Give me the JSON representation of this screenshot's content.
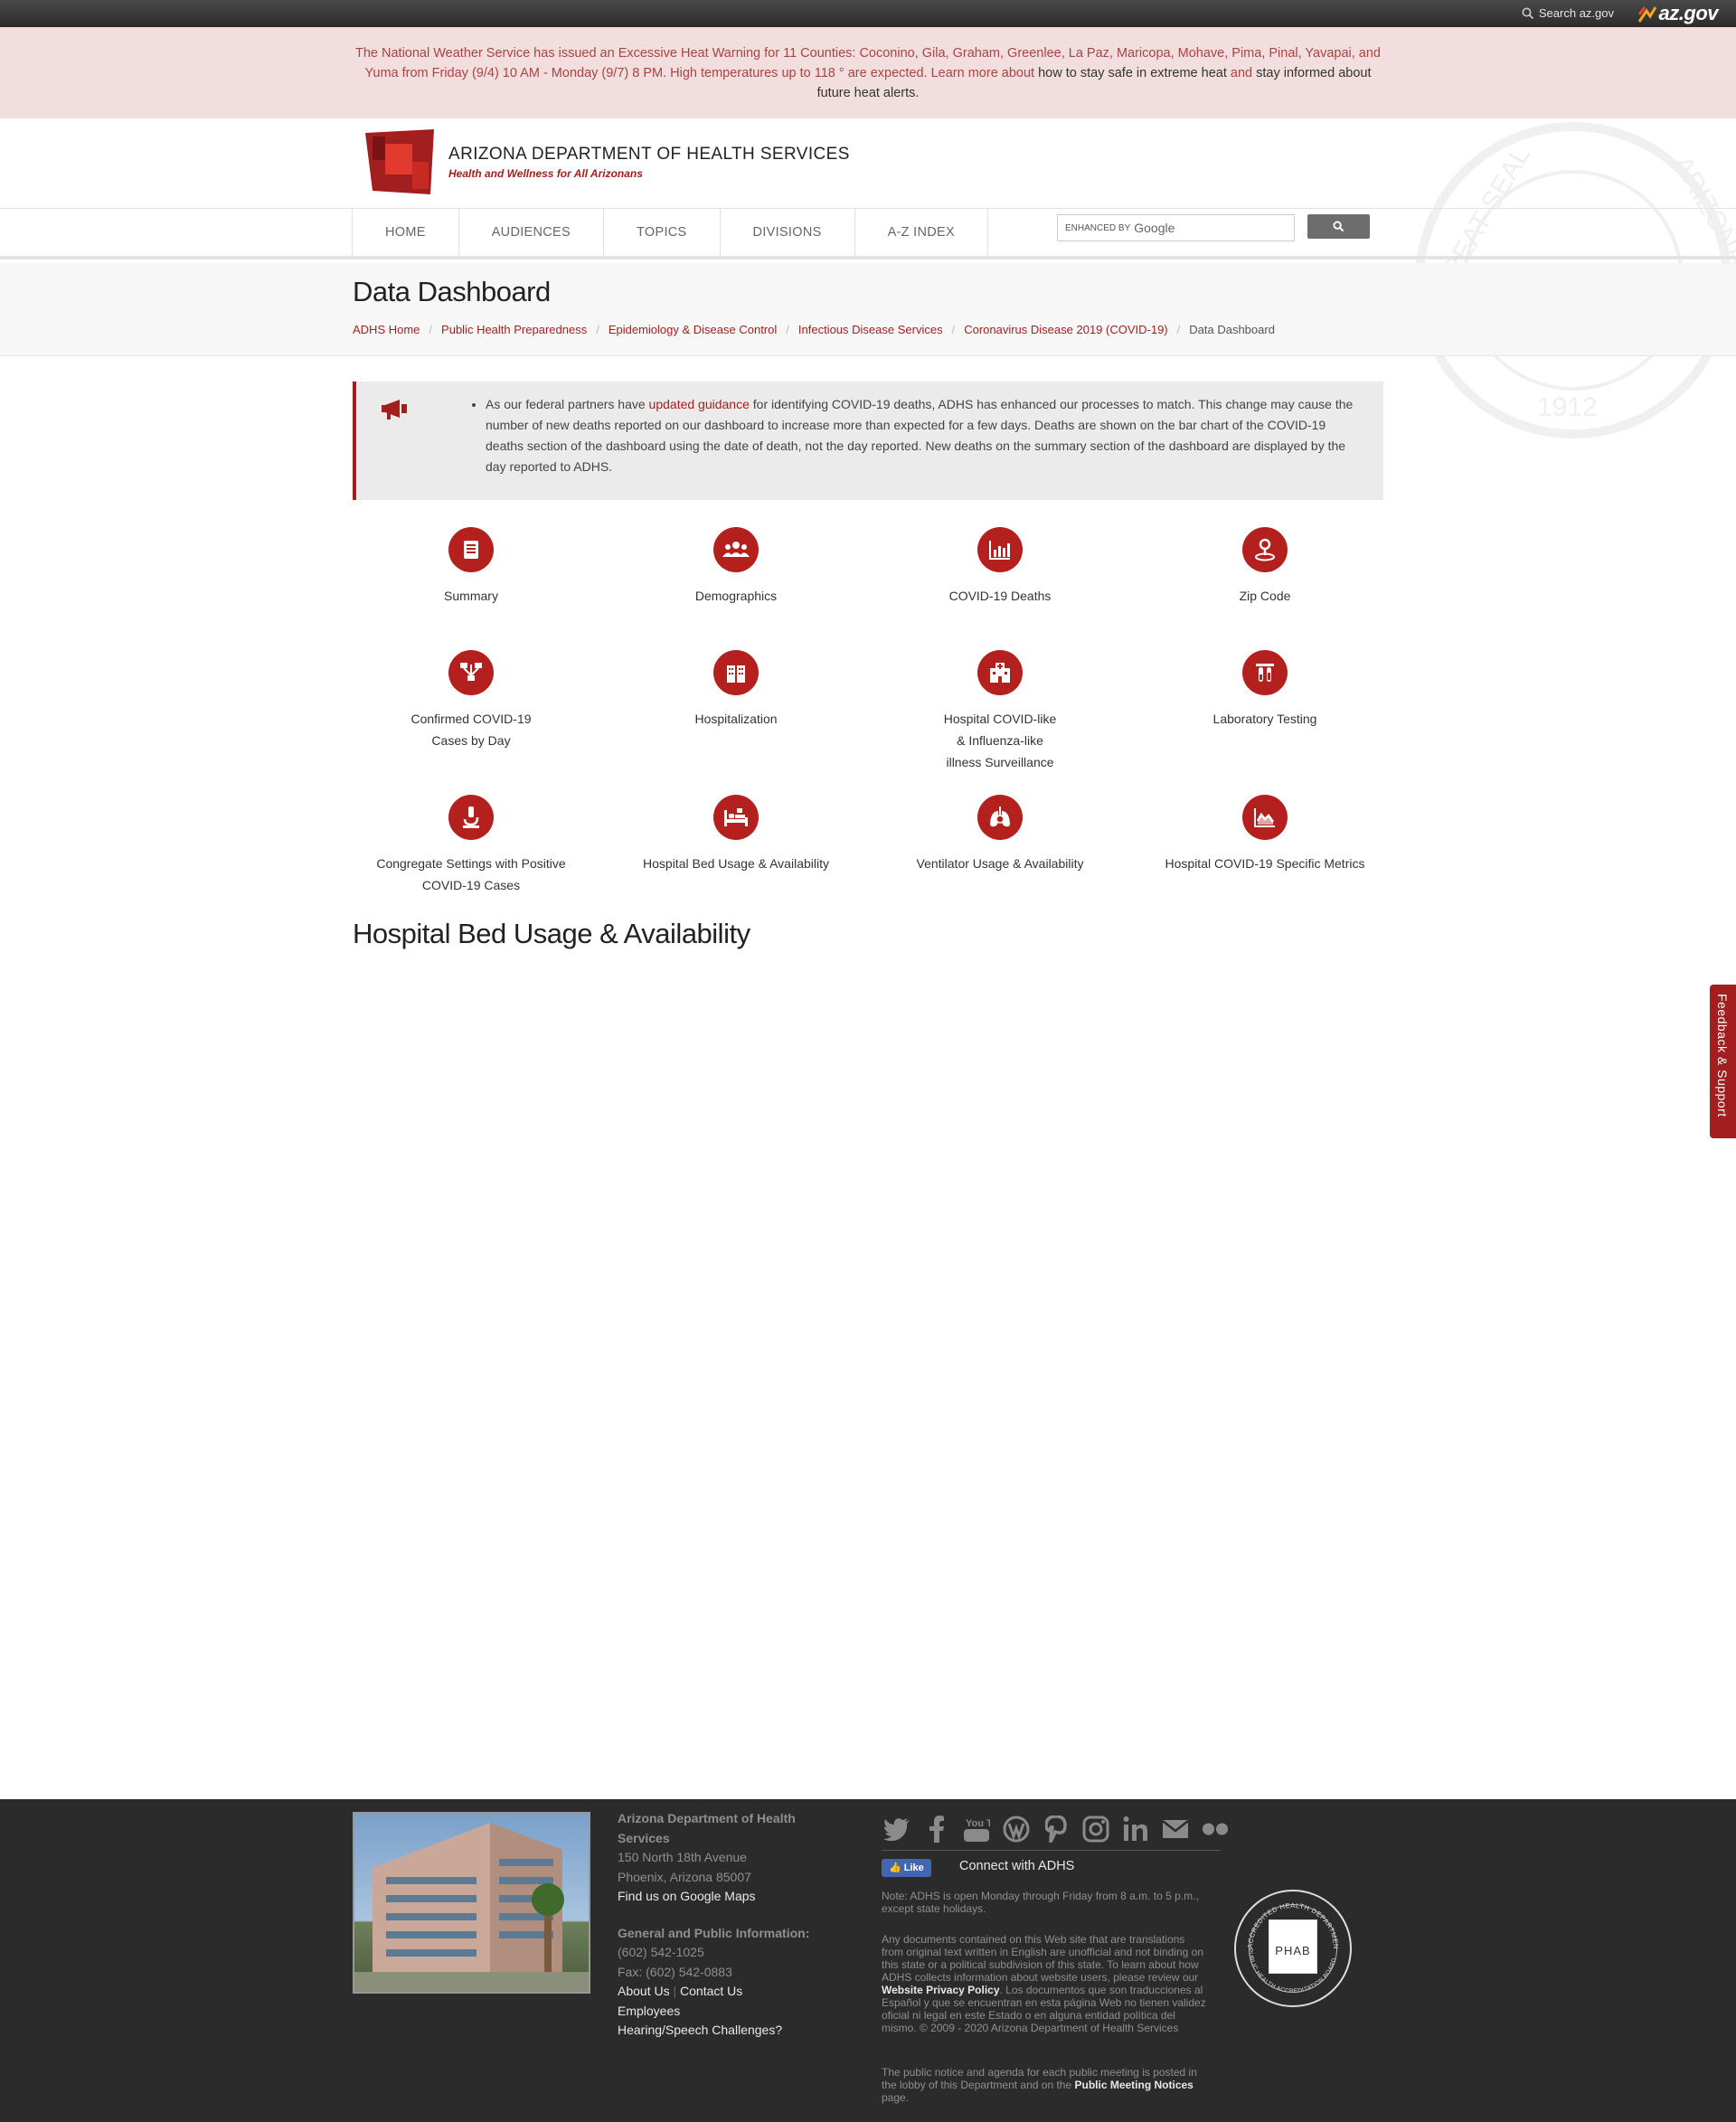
{
  "azbar": {
    "search_label": "Search az.gov",
    "logo_text": "az.gov"
  },
  "alert": {
    "part1": "The National Weather Service has issued an Excessive Heat Warning for 11 Counties: Coconino, Gila, Graham, Greenlee, La Paz, Maricopa, Mohave, Pima, Pinal, Yavapai, and Yuma from Friday (9/4) 10 AM - Monday (9/7) 8 PM. High temperatures up to 118 ° are expected. Learn more about",
    "link1": "how to stay safe in extreme heat",
    "and": "and",
    "link2": "stay informed about future heat alerts."
  },
  "header": {
    "agency_name": "ARIZONA DEPARTMENT OF HEALTH SERVICES",
    "tagline": "Health and Wellness for All Arizonans",
    "seal_year": "1912",
    "seal_text_left": "GREAT SEAL",
    "seal_text_right": "ARIZONA"
  },
  "nav": {
    "items": [
      "HOME",
      "AUDIENCES",
      "TOPICS",
      "DIVISIONS",
      "A-Z INDEX"
    ],
    "search_prefix": "ENHANCED BY",
    "search_brand": "Google"
  },
  "page": {
    "title": "Data Dashboard",
    "breadcrumbs": [
      "ADHS Home",
      "Public Health Preparedness",
      "Epidemiology & Disease Control",
      "Infectious Disease Services",
      "Coronavirus Disease 2019 (COVID-19)"
    ],
    "breadcrumb_current": "Data Dashboard",
    "breadcrumb_sep": "/"
  },
  "notice": {
    "pre": "As our federal partners have",
    "link": "updated guidance",
    "post": "for identifying COVID-19 deaths, ADHS has enhanced our processes to match. This change may cause the number of new deaths reported on our dashboard to increase more than expected for a few days. Deaths are shown on the bar chart of the COVID-19 deaths section of the dashboard using the date of death, not the day reported. New deaths on the summary section of the dashboard are displayed by the day reported to ADHS."
  },
  "tiles": [
    {
      "label": "Summary",
      "icon": "document-icon"
    },
    {
      "label": "Demographics",
      "icon": "people-icon"
    },
    {
      "label": "COVID-19 Deaths",
      "icon": "bar-chart-icon"
    },
    {
      "label": "Zip Code",
      "icon": "location-pin-icon"
    },
    {
      "label": "Confirmed COVID-19",
      "label2": "Cases by Day",
      "icon": "network-icon"
    },
    {
      "label": "Hospitalization",
      "icon": "hospital-building-icon"
    },
    {
      "label": "Hospital COVID-like",
      "label2": "& Influenza-like",
      "label3": "illness Surveillance",
      "icon": "clinic-icon"
    },
    {
      "label": "Laboratory Testing",
      "icon": "test-tubes-icon"
    },
    {
      "label": "Congregate Settings with Positive",
      "label2": "COVID-19 Cases",
      "icon": "microscope-icon"
    },
    {
      "label": "Hospital Bed Usage & Availability",
      "icon": "hospital-bed-icon"
    },
    {
      "label": "Ventilator Usage & Availability",
      "icon": "lungs-icon"
    },
    {
      "label": "Hospital COVID-19 Specific Metrics",
      "icon": "trend-chart-icon"
    }
  ],
  "section_title": "Hospital Bed Usage & Availability",
  "feedback_label": "Feedback & Support",
  "footer": {
    "org": "Arizona Department of Health Services",
    "address1": "150 North 18th Avenue",
    "address2": "Phoenix, Arizona 85007",
    "maps_link": "Find us on Google Maps",
    "info_heading": "General and Public Information:",
    "phone": "(602) 542-1025",
    "fax": "Fax: (602) 542-0883",
    "about": "About Us",
    "contact": "Contact Us",
    "employees": "Employees",
    "hearing": "Hearing/Speech Challenges?",
    "link_sep": "|",
    "social": [
      "twitter-icon",
      "facebook-icon",
      "youtube-icon",
      "wordpress-icon",
      "pinterest-icon",
      "instagram-icon",
      "linkedin-icon",
      "email-icon",
      "flickr-icon"
    ],
    "youtube_text": "You Tube",
    "fb_like": "Like",
    "connect": "Connect with ADHS",
    "hours_note": "Note: ADHS is open Monday through Friday from 8 a.m. to 5 p.m., except state holidays.",
    "disclaimer_pre": "Any documents contained on this Web site that are translations from original text written in English are unofficial and not binding on this state or a political subdivision of this state. To learn about how ADHS collects information about website users, please review our",
    "privacy_link": "Website Privacy Policy",
    "disclaimer_post": ". Los documentos que son traducciones al Español y que se encuentran en esta página Web no tienen validez oficial ni legal en este Estado o en alguna entidad política del mismo. © 2009 - 2020 Arizona Department of Health Services",
    "notice_pre": "The public notice and agenda for each public meeting is posted in the lobby of this Department and on the",
    "notice_link": "Public Meeting Notices",
    "notice_post": "page.",
    "phab_text": "PHAB",
    "phab_ring_top": "ACCREDITED HEALTH DEPARTMENT",
    "phab_ring_bottom": "PUBLIC HEALTH ACCREDITATION BOARD"
  }
}
